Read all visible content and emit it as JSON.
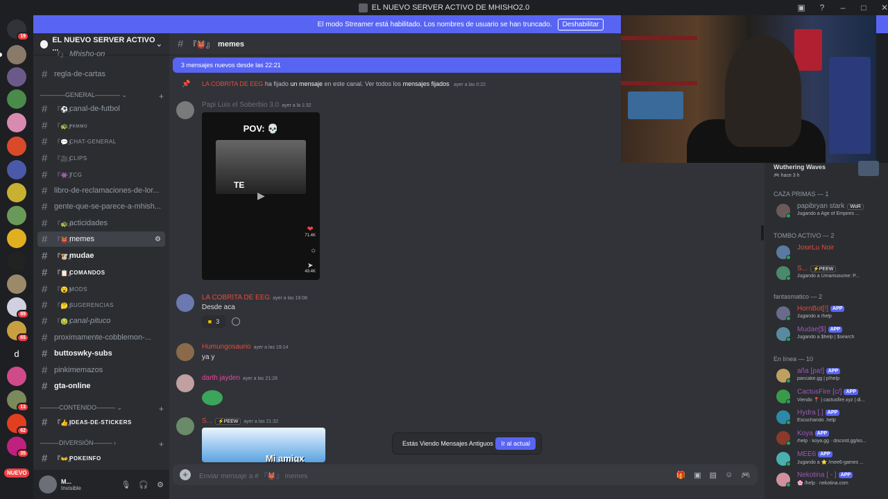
{
  "window": {
    "title": "EL NUEVO SERVER ACTIVO DE MHISHO2.0"
  },
  "streamer_bar": {
    "text": "El modo Streamer está habilitado. Los nombres de usuario se han truncado.",
    "button": "Deshabilitar"
  },
  "server_list": {
    "badges": [
      "19",
      "89",
      "65",
      "13",
      "62",
      "35"
    ],
    "letter": "d",
    "new_label": "NUEVO"
  },
  "server": {
    "name": "EL NUEVO SERVER ACTIVO ...",
    "partial_top": "Mhisho-on",
    "categories": {
      "general": "GENERAL",
      "contenido": "CONTENIDO",
      "diversion": "DIVERSIÓN"
    },
    "channels": [
      "regla-de-cartas",
      "canal-de-futbol",
      "ᴘᴋᴍᴍᴏ",
      "CHAT-GENERAL",
      "CLIPS",
      "TCG",
      "libro-de-reclamaciones-de-lor...",
      "gente-que-se-parece-a-mhish...",
      "acticidades",
      "memes",
      "mudae",
      "COMANDOS",
      "MODS",
      "SUGERENCIAS",
      "canal-pituco",
      "proximamente-cobblemon-...",
      "buttoswky-subs",
      "pinkimemazos",
      "gta-online",
      "IDEAS-DE-STICKERS",
      "POKEINFO"
    ]
  },
  "user_panel": {
    "name": "M...",
    "status": "Invisible"
  },
  "chat": {
    "channel": "memes",
    "new_messages": "3 mensajes nuevos desde las 22:21",
    "system": {
      "who": "LA COBRITA DE EEG",
      "t1": "ha fijado",
      "b1": "un mensaje",
      "t2": "en este canal. Ver todos los",
      "b2": "mensajes fijados",
      "time": "ayer a las 0:22"
    },
    "messages": [
      {
        "author": "Papi Luis el Soberbio 3.0",
        "time": "ayer a la 1:32",
        "video_caption": "POV: 💀",
        "video_text": "TE",
        "likes": "71.4K",
        "shares": "49.4K"
      },
      {
        "author": "LA COBRITA DE EEG",
        "time": "ayer a las 19:08",
        "text": "Desde aca",
        "reaction_count": "3"
      },
      {
        "author": "Humungosaurio",
        "time": "ayer a las 19:14",
        "text": "ya y"
      },
      {
        "author": "darth jayden",
        "time": "ayer a las 21:28"
      },
      {
        "author": "S...",
        "tag": "⚡PEEW",
        "time": "ayer a las 21:32",
        "image_text": "Mi amigx"
      }
    ],
    "old_messages": {
      "text": "Estás Viendo Mensajes Antiguos",
      "button": "Ir al actual"
    },
    "composer_placeholder": "Enviar mensaje a # 『👹』 memes"
  },
  "activity": {
    "game": "Wuthering Waves",
    "ago": "hace 3 h"
  },
  "members": {
    "groups": [
      {
        "title": "CAZA PRIMAS — 1",
        "items": [
          {
            "name": "papibryan stark",
            "tag": "WoR",
            "activity": "Jugando a Age of Empires ...",
            "color": "#949ba4"
          }
        ]
      },
      {
        "title": "TOMBO ACTIVO — 2",
        "items": [
          {
            "name": "JoseLu Noir",
            "activity": "",
            "color": "#e74c3c"
          },
          {
            "name": "S...",
            "tag": "⚡PEEW",
            "activity": "Jugando a Umamusume: P...",
            "color": "#e74c3c"
          }
        ]
      },
      {
        "title": "fantasmatico — 2",
        "items": [
          {
            "name": "HornBot[!]",
            "app": "APP",
            "activity": "Jugando a /help",
            "color": "#e74c3c"
          },
          {
            "name": "Mudae[$]",
            "app": "APP",
            "activity": "Jugando a $help | $search",
            "color": "#9b59b6"
          }
        ]
      },
      {
        "title": "En línea — 10",
        "items": [
          {
            "name": "aña [pa!]",
            "app": "APP",
            "activity": "pancake.gg | p!help",
            "color": "#9b59b6"
          },
          {
            "name": "CactusFire [c/]",
            "app": "APP",
            "activity": "Viendo 📍 | cactusfire.xyz | di...",
            "color": "#9b59b6"
          },
          {
            "name": "Hydra [.]",
            "app": "APP",
            "activity": "Escuchando .help",
            "color": "#9b59b6"
          },
          {
            "name": "Koya",
            "app": "APP",
            "activity": "/help · koya.gg · discord.gg/ko...",
            "color": "#9b59b6"
          },
          {
            "name": "MEE6",
            "app": "APP",
            "activity": "Jugando a ⭐ /mee6-games ...",
            "color": "#9b59b6"
          },
          {
            "name": "Nekotina [ - ]",
            "app": "APP",
            "activity": "🌸 /help · nekotina.com",
            "color": "#9b59b6"
          }
        ]
      }
    ]
  }
}
